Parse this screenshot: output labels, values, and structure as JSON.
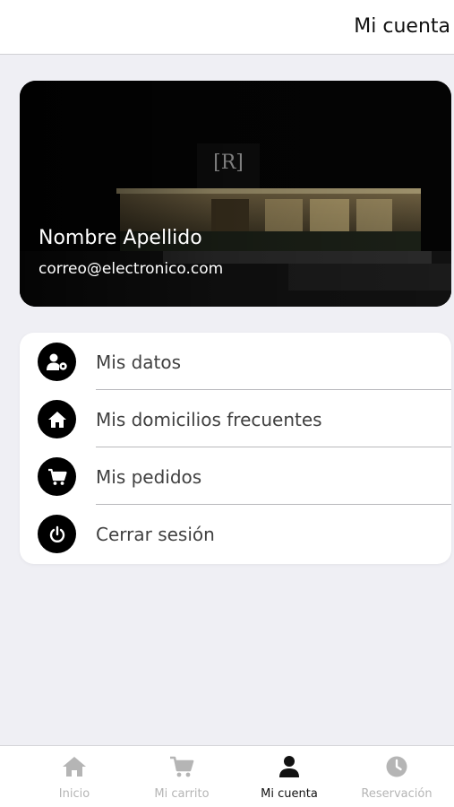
{
  "header": {
    "title": "Mi cuenta"
  },
  "profile": {
    "name": "Nombre Apellido",
    "email": "correo@electronico.com"
  },
  "menu": {
    "items": [
      {
        "label": "Mis datos",
        "icon": "user-gear-icon"
      },
      {
        "label": "Mis domicilios frecuentes",
        "icon": "home-icon"
      },
      {
        "label": "Mis pedidos",
        "icon": "cart-icon"
      },
      {
        "label": "Cerrar sesión",
        "icon": "power-icon"
      }
    ]
  },
  "tabs": [
    {
      "label": "Inicio",
      "icon": "home-icon",
      "active": false
    },
    {
      "label": "Mi carrito",
      "icon": "cart-icon",
      "active": false
    },
    {
      "label": "Mi cuenta",
      "icon": "user-icon",
      "active": true
    },
    {
      "label": "Reservación",
      "icon": "clock-icon",
      "active": false
    }
  ],
  "colors": {
    "active_tab": "#111111",
    "inactive_tab": "#b5b5b5",
    "icon_circle": "#000000",
    "background": "#efeff4"
  }
}
